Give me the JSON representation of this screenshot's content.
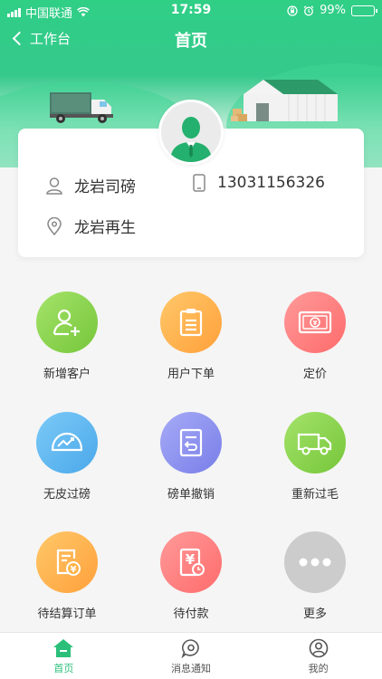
{
  "status_bar": {
    "carrier": "中国联通",
    "time": "17:59",
    "battery": "99%"
  },
  "nav": {
    "back_label": "工作台",
    "title": "首页"
  },
  "profile": {
    "name": "龙岩司磅",
    "phone": "13031156326",
    "location": "龙岩再生"
  },
  "actions": [
    {
      "label": "新增客户",
      "icon": "add-user-icon",
      "color": "#8ad64a"
    },
    {
      "label": "用户下单",
      "icon": "clipboard-icon",
      "color": "#ffb347"
    },
    {
      "label": "定价",
      "icon": "banknote-icon",
      "color": "#ff7f7f"
    },
    {
      "label": "无皮过磅",
      "icon": "gauge-icon",
      "color": "#5fb8f0"
    },
    {
      "label": "磅单撤销",
      "icon": "undo-document-icon",
      "color": "#8a8ff0"
    },
    {
      "label": "重新过毛",
      "icon": "truck-icon",
      "color": "#8ad64a"
    },
    {
      "label": "待结算订单",
      "icon": "yuan-document-icon",
      "color": "#ffb347"
    },
    {
      "label": "待付款",
      "icon": "yuan-clock-icon",
      "color": "#ff7f7f"
    },
    {
      "label": "更多",
      "icon": "more-icon",
      "color": "#cccccc"
    }
  ],
  "tabs": [
    {
      "label": "首页",
      "active": true
    },
    {
      "label": "消息通知",
      "active": false
    },
    {
      "label": "我的",
      "active": false
    }
  ],
  "colors": {
    "primary": "#2bbf7a"
  }
}
